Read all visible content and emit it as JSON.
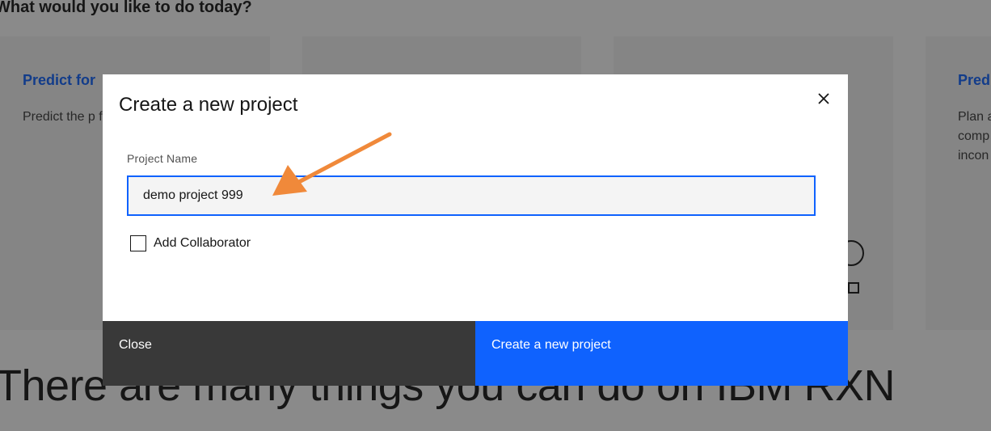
{
  "background": {
    "section_heading": "What would you like to do today?",
    "cards": [
      {
        "title": "Predict for",
        "description": "Predict the p from its pred"
      },
      {
        "title": "",
        "description": ""
      },
      {
        "title": "",
        "description": ""
      },
      {
        "title": "Pred",
        "description": "Plan a comp incon"
      }
    ],
    "hero_text": "There are many things you can do on IBM RXN"
  },
  "modal": {
    "title": "Create a new project",
    "close_icon": "close-icon",
    "project_name": {
      "label": "Project Name",
      "value": "demo project 999",
      "placeholder": ""
    },
    "add_collaborator": {
      "label": "Add Collaborator",
      "checked": false
    },
    "footer": {
      "close_label": "Close",
      "create_label": "Create a new project"
    }
  },
  "colors": {
    "primary": "#0f62fe",
    "secondary_button": "#393939",
    "annotation_arrow": "#f0893a",
    "overlay": "rgba(22,22,22,0.5)"
  }
}
